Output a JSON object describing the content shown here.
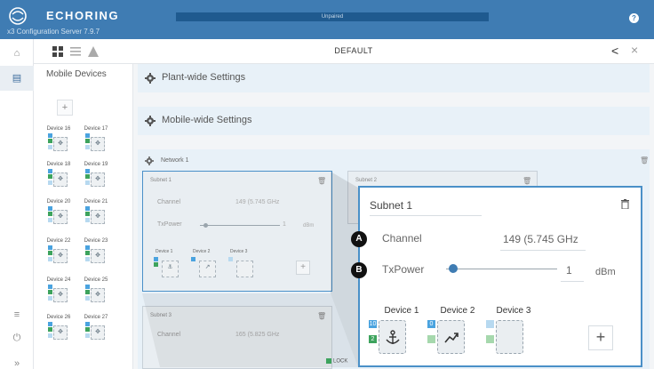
{
  "header": {
    "brand": "ECHORING",
    "subtitle": "x3 Configuration Server 7.9.7",
    "status": "Unpaired",
    "help_symbol": "?"
  },
  "rail": {
    "items": [
      {
        "icon": "home-icon",
        "glyph": "⌂"
      },
      {
        "icon": "devices-icon",
        "glyph": "▤"
      },
      {
        "icon": "menu-icon",
        "glyph": "≡"
      },
      {
        "icon": "power-icon",
        "glyph": "⏻"
      },
      {
        "icon": "expand-icon",
        "glyph": "»"
      }
    ]
  },
  "toolbar": {
    "title": "DEFAULT",
    "back_symbol": "<",
    "close_symbol": "×"
  },
  "devices_panel": {
    "title": "Mobile Devices",
    "add_symbol": "+",
    "devices": [
      "Device 16",
      "Device 17",
      "Device 18",
      "Device 19",
      "Device 20",
      "Device 21",
      "Device 22",
      "Device 23",
      "Device 24",
      "Device 25",
      "Device 26",
      "Device 27"
    ]
  },
  "sections": {
    "plant": "Plant-wide Settings",
    "mobile": "Mobile-wide Settings",
    "network": "Network 1"
  },
  "subnets": [
    {
      "title": "Subnet 1",
      "channel_label": "Channel",
      "channel_value": "149 (5.745 GHz",
      "txpower_label": "TxPower",
      "txpower_value": "1",
      "txpower_unit": "dBm",
      "devices": [
        "Device 1",
        "Device 2",
        "Device 3"
      ]
    },
    {
      "title": "Subnet 2"
    },
    {
      "title": "Subnet 3",
      "channel_label": "Channel",
      "channel_value": "165 (5.825 GHz"
    }
  ],
  "zoom": {
    "title": "Subnet 1",
    "channel_label": "Channel",
    "channel_value": "149 (5.745 GHz",
    "txpower_label": "TxPower",
    "txpower_value": "1",
    "txpower_unit": "dBm",
    "txpower_level": 0.06,
    "marker_a": "A",
    "marker_b": "B",
    "add_symbol": "+",
    "devices": [
      {
        "name": "Device 1",
        "badge_top": "10",
        "badge_mid": "2",
        "icon": "anchor-icon"
      },
      {
        "name": "Device 2",
        "badge_top": "0",
        "badge_mid": "",
        "icon": "trend-icon"
      },
      {
        "name": "Device 3",
        "badge_top": "",
        "badge_mid": "",
        "icon": "empty"
      }
    ]
  },
  "footer": {
    "lock_label": "LOCK"
  },
  "colors": {
    "header": "#3f7cb3",
    "accent": "#4a90c8",
    "badge_blue": "#4aa3df",
    "badge_green": "#3da35d"
  }
}
